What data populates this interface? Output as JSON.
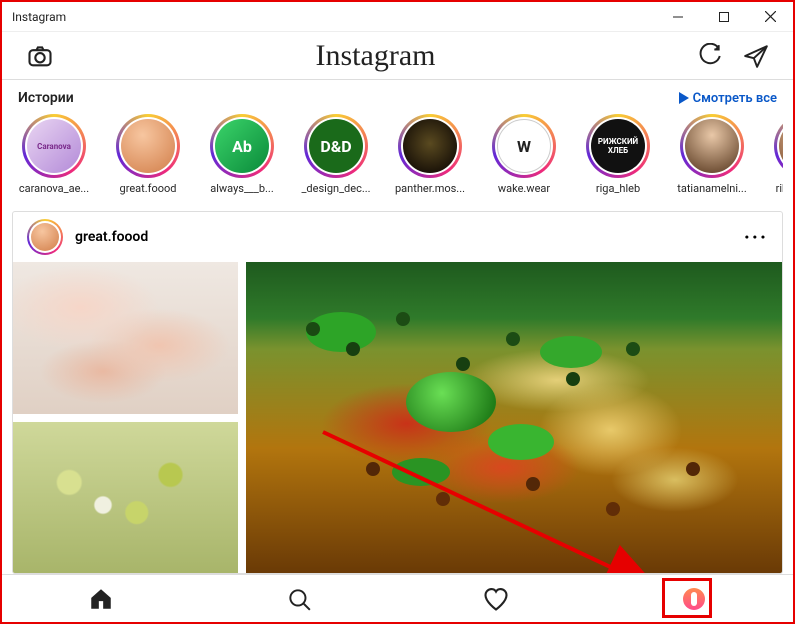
{
  "window": {
    "title": "Instagram"
  },
  "header": {
    "logo_text": "Instagram"
  },
  "stories": {
    "title": "Истории",
    "watch_all": "Смотреть все",
    "items": [
      {
        "username": "caranova_ae...",
        "avatar_label": "Caranova",
        "bg": "linear-gradient(135deg,#e9d5f2,#b38ad8)",
        "fg": "#7a2a8a"
      },
      {
        "username": "great.foood",
        "avatar_label": "",
        "bg": "radial-gradient(circle at 40% 30%, #f7c6a0, #d98c5a 80%)",
        "fg": "#fff"
      },
      {
        "username": "always___b...",
        "avatar_label": "Ab",
        "bg": "linear-gradient(135deg,#3bd46a,#0a8a3a)",
        "fg": "#fff"
      },
      {
        "username": "_design_dec...",
        "avatar_label": "D&D",
        "bg": "#1a6a1a",
        "fg": "#fff"
      },
      {
        "username": "panther.mos...",
        "avatar_label": "",
        "bg": "radial-gradient(circle at 50% 45%, #5a4a20, #1a1208 75%)",
        "fg": "#caa23a"
      },
      {
        "username": "wake.wear",
        "avatar_label": "W",
        "bg": "#ffffff",
        "fg": "#222"
      },
      {
        "username": "riga_hleb",
        "avatar_label": "РИЖСКИЙ ХЛЕБ",
        "bg": "#111",
        "fg": "#fff"
      },
      {
        "username": "tatianamelni...",
        "avatar_label": "",
        "bg": "radial-gradient(circle at 50% 30%, #e9c8a8, #6a4a30 85%)",
        "fg": "#fff"
      },
      {
        "username": "rikiperetzma",
        "avatar_label": "",
        "bg": "radial-gradient(circle at 50% 30%, #e8c2a0, #8a5a3a 85%)",
        "fg": "#fff"
      }
    ]
  },
  "post": {
    "username": "great.foood"
  },
  "nav": {
    "items": [
      "home",
      "search",
      "activity",
      "profile"
    ]
  }
}
